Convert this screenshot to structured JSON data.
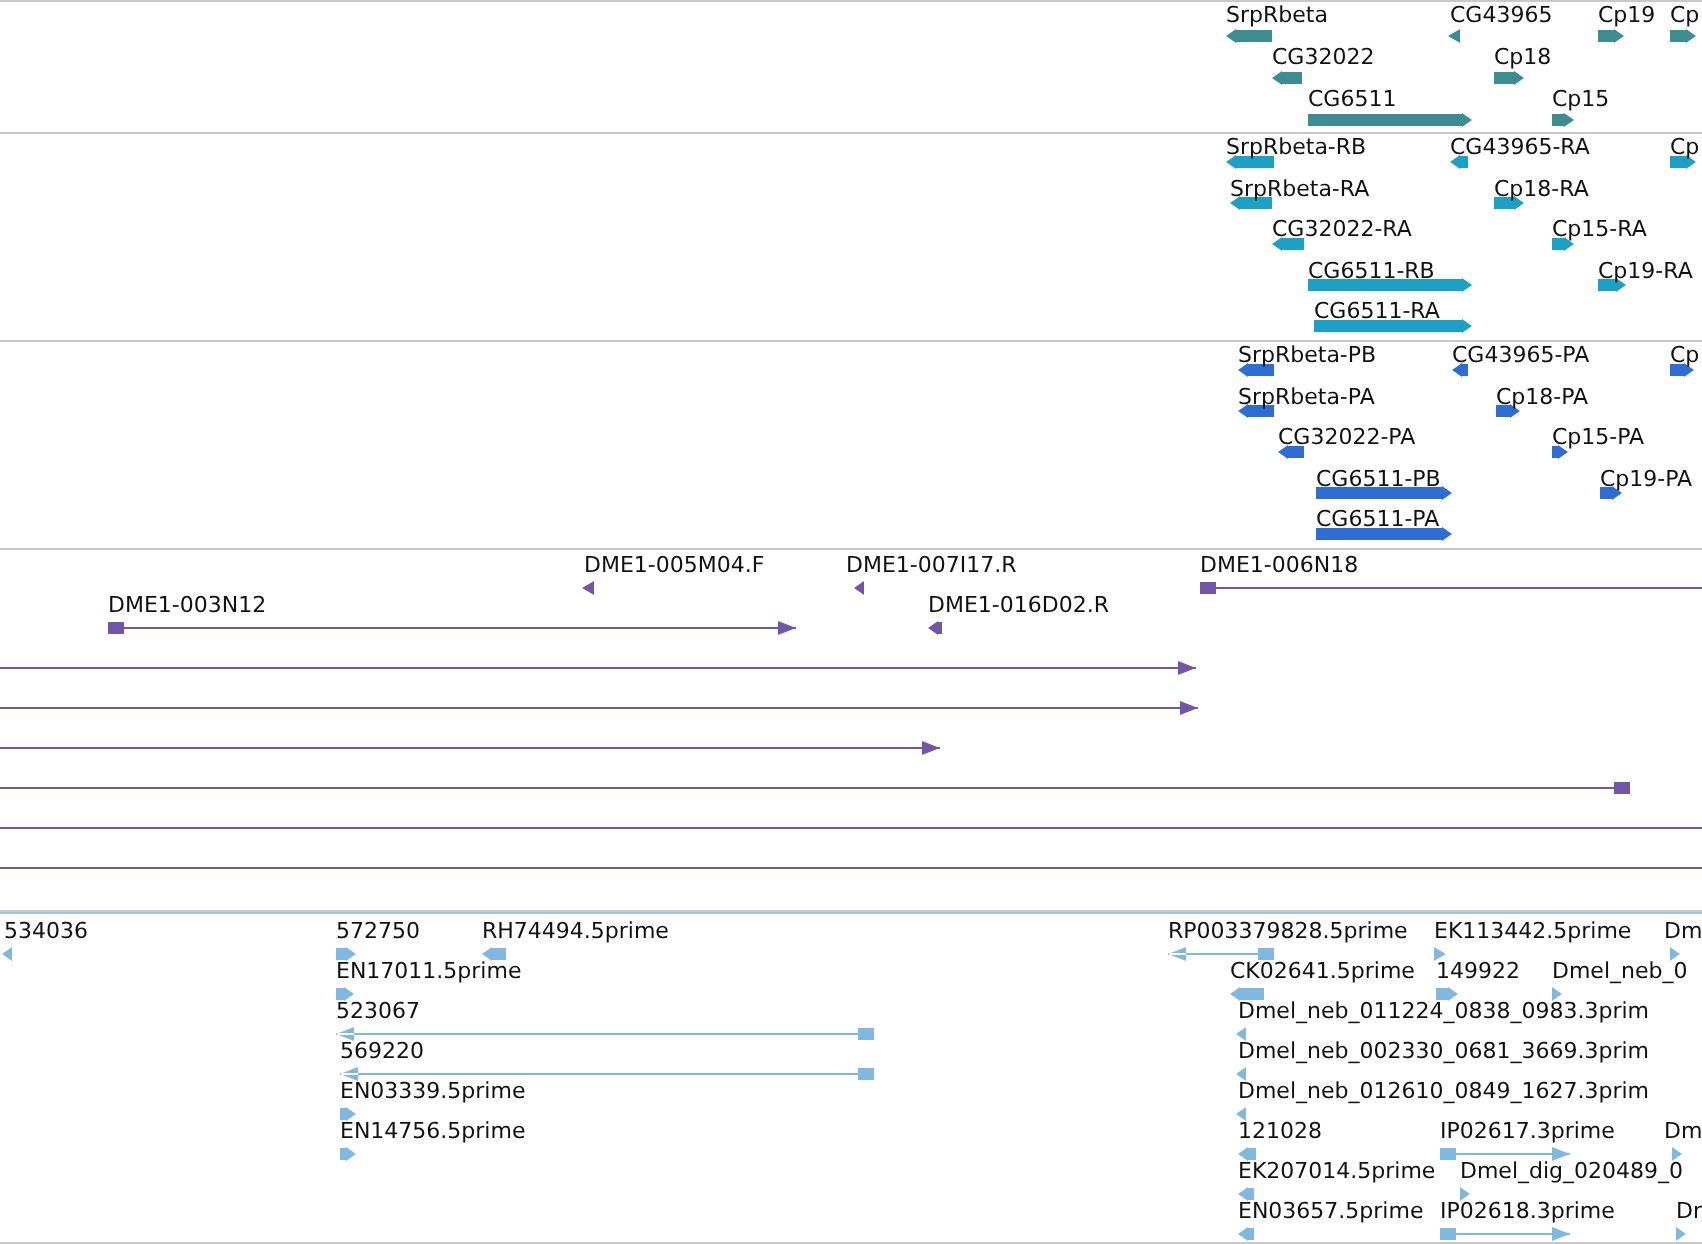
{
  "tracks": [
    {
      "color": "#3d8c92",
      "features": [
        {
          "label": "SrpRbeta",
          "kind": "block",
          "reverse": true
        },
        {
          "label": "CG43965",
          "kind": "block",
          "reverse": true
        },
        {
          "label": "Cp19",
          "kind": "block",
          "reverse": false
        },
        {
          "label": "Cp",
          "kind": "block",
          "reverse": false
        },
        {
          "label": "CG32022",
          "kind": "block",
          "reverse": true
        },
        {
          "label": "Cp18",
          "kind": "block",
          "reverse": false
        },
        {
          "label": "CG6511",
          "kind": "block",
          "reverse": false
        },
        {
          "label": "Cp15",
          "kind": "block",
          "reverse": false
        }
      ]
    },
    {
      "color": "#1ca0c4",
      "features": [
        {
          "label": "SrpRbeta-RB",
          "kind": "block",
          "reverse": true
        },
        {
          "label": "CG43965-RA",
          "kind": "block",
          "reverse": true
        },
        {
          "label": "Cp",
          "kind": "block",
          "reverse": false
        },
        {
          "label": "SrpRbeta-RA",
          "kind": "block",
          "reverse": true
        },
        {
          "label": "Cp18-RA",
          "kind": "block",
          "reverse": false
        },
        {
          "label": "CG32022-RA",
          "kind": "block",
          "reverse": true
        },
        {
          "label": "Cp15-RA",
          "kind": "block",
          "reverse": false
        },
        {
          "label": "CG6511-RB",
          "kind": "block",
          "reverse": false
        },
        {
          "label": "Cp19-RA",
          "kind": "block",
          "reverse": false
        },
        {
          "label": "CG6511-RA",
          "kind": "block",
          "reverse": false
        }
      ]
    },
    {
      "color": "#2f6dd2",
      "features": [
        {
          "label": "SrpRbeta-PB",
          "kind": "block",
          "reverse": true
        },
        {
          "label": "CG43965-PA",
          "kind": "block",
          "reverse": true
        },
        {
          "label": "Cp",
          "kind": "block",
          "reverse": false
        },
        {
          "label": "SrpRbeta-PA",
          "kind": "block",
          "reverse": true
        },
        {
          "label": "Cp18-PA",
          "kind": "block",
          "reverse": false
        },
        {
          "label": "CG32022-PA",
          "kind": "block",
          "reverse": true
        },
        {
          "label": "Cp15-PA",
          "kind": "block",
          "reverse": false
        },
        {
          "label": "CG6511-PB",
          "kind": "block",
          "reverse": false
        },
        {
          "label": "Cp19-PA",
          "kind": "block",
          "reverse": false
        },
        {
          "label": "CG6511-PA",
          "kind": "block",
          "reverse": false
        }
      ]
    },
    {
      "color": "#7355a8",
      "features": [
        {
          "label": "DME1-005M04.F",
          "kind": "block",
          "reverse": true
        },
        {
          "label": "DME1-007I17.R",
          "kind": "block",
          "reverse": true
        },
        {
          "label": "DME1-006N18",
          "kind": "line",
          "reverse": false
        },
        {
          "label": "DME1-003N12",
          "kind": "line",
          "reverse": false
        },
        {
          "label": "DME1-016D02.R",
          "kind": "block",
          "reverse": true
        },
        {
          "kind": "line",
          "reverse": false
        },
        {
          "kind": "line",
          "reverse": false
        },
        {
          "kind": "line",
          "reverse": false
        },
        {
          "kind": "line",
          "reverse": true
        },
        {
          "kind": "line"
        },
        {
          "kind": "line"
        }
      ]
    },
    {
      "color": "#80b8e0",
      "features": [
        {
          "label": "534036",
          "kind": "block",
          "reverse": true
        },
        {
          "label": "572750",
          "kind": "block",
          "reverse": false
        },
        {
          "label": "RH74494.5prime",
          "kind": "block",
          "reverse": true
        },
        {
          "label": "RP003379828.5prime",
          "kind": "line",
          "reverse": true
        },
        {
          "label": "EK113442.5prime",
          "kind": "block",
          "reverse": false
        },
        {
          "label": "Dm",
          "kind": "block",
          "reverse": false
        },
        {
          "label": "EN17011.5prime",
          "kind": "block",
          "reverse": false
        },
        {
          "label": "CK02641.5prime",
          "kind": "block",
          "reverse": true
        },
        {
          "label": "149922",
          "kind": "block",
          "reverse": false
        },
        {
          "label": "Dmel_neb_0",
          "kind": "block",
          "reverse": false
        },
        {
          "label": "523067",
          "kind": "line",
          "reverse": true
        },
        {
          "label": "Dmel_neb_011224_0838_0983.3prim",
          "kind": "block",
          "reverse": true
        },
        {
          "label": "569220",
          "kind": "line",
          "reverse": true
        },
        {
          "label": "Dmel_neb_002330_0681_3669.3prim",
          "kind": "block",
          "reverse": true
        },
        {
          "label": "EN03339.5prime",
          "kind": "block",
          "reverse": false
        },
        {
          "label": "Dmel_neb_012610_0849_1627.3prim",
          "kind": "block",
          "reverse": true
        },
        {
          "label": "EN14756.5prime",
          "kind": "block",
          "reverse": false
        },
        {
          "label": "121028",
          "kind": "block",
          "reverse": true
        },
        {
          "label": "IP02617.3prime",
          "kind": "line",
          "reverse": false
        },
        {
          "label": "Dm",
          "kind": "block",
          "reverse": false
        },
        {
          "label": "EK207014.5prime",
          "kind": "block",
          "reverse": true
        },
        {
          "label": "Dmel_dig_020489_0",
          "kind": "block",
          "reverse": false
        },
        {
          "label": "EN03657.5prime",
          "kind": "block",
          "reverse": true
        },
        {
          "label": "IP02618.3prime",
          "kind": "line",
          "reverse": false
        },
        {
          "label": "Dr",
          "kind": "block",
          "reverse": false
        }
      ]
    }
  ]
}
